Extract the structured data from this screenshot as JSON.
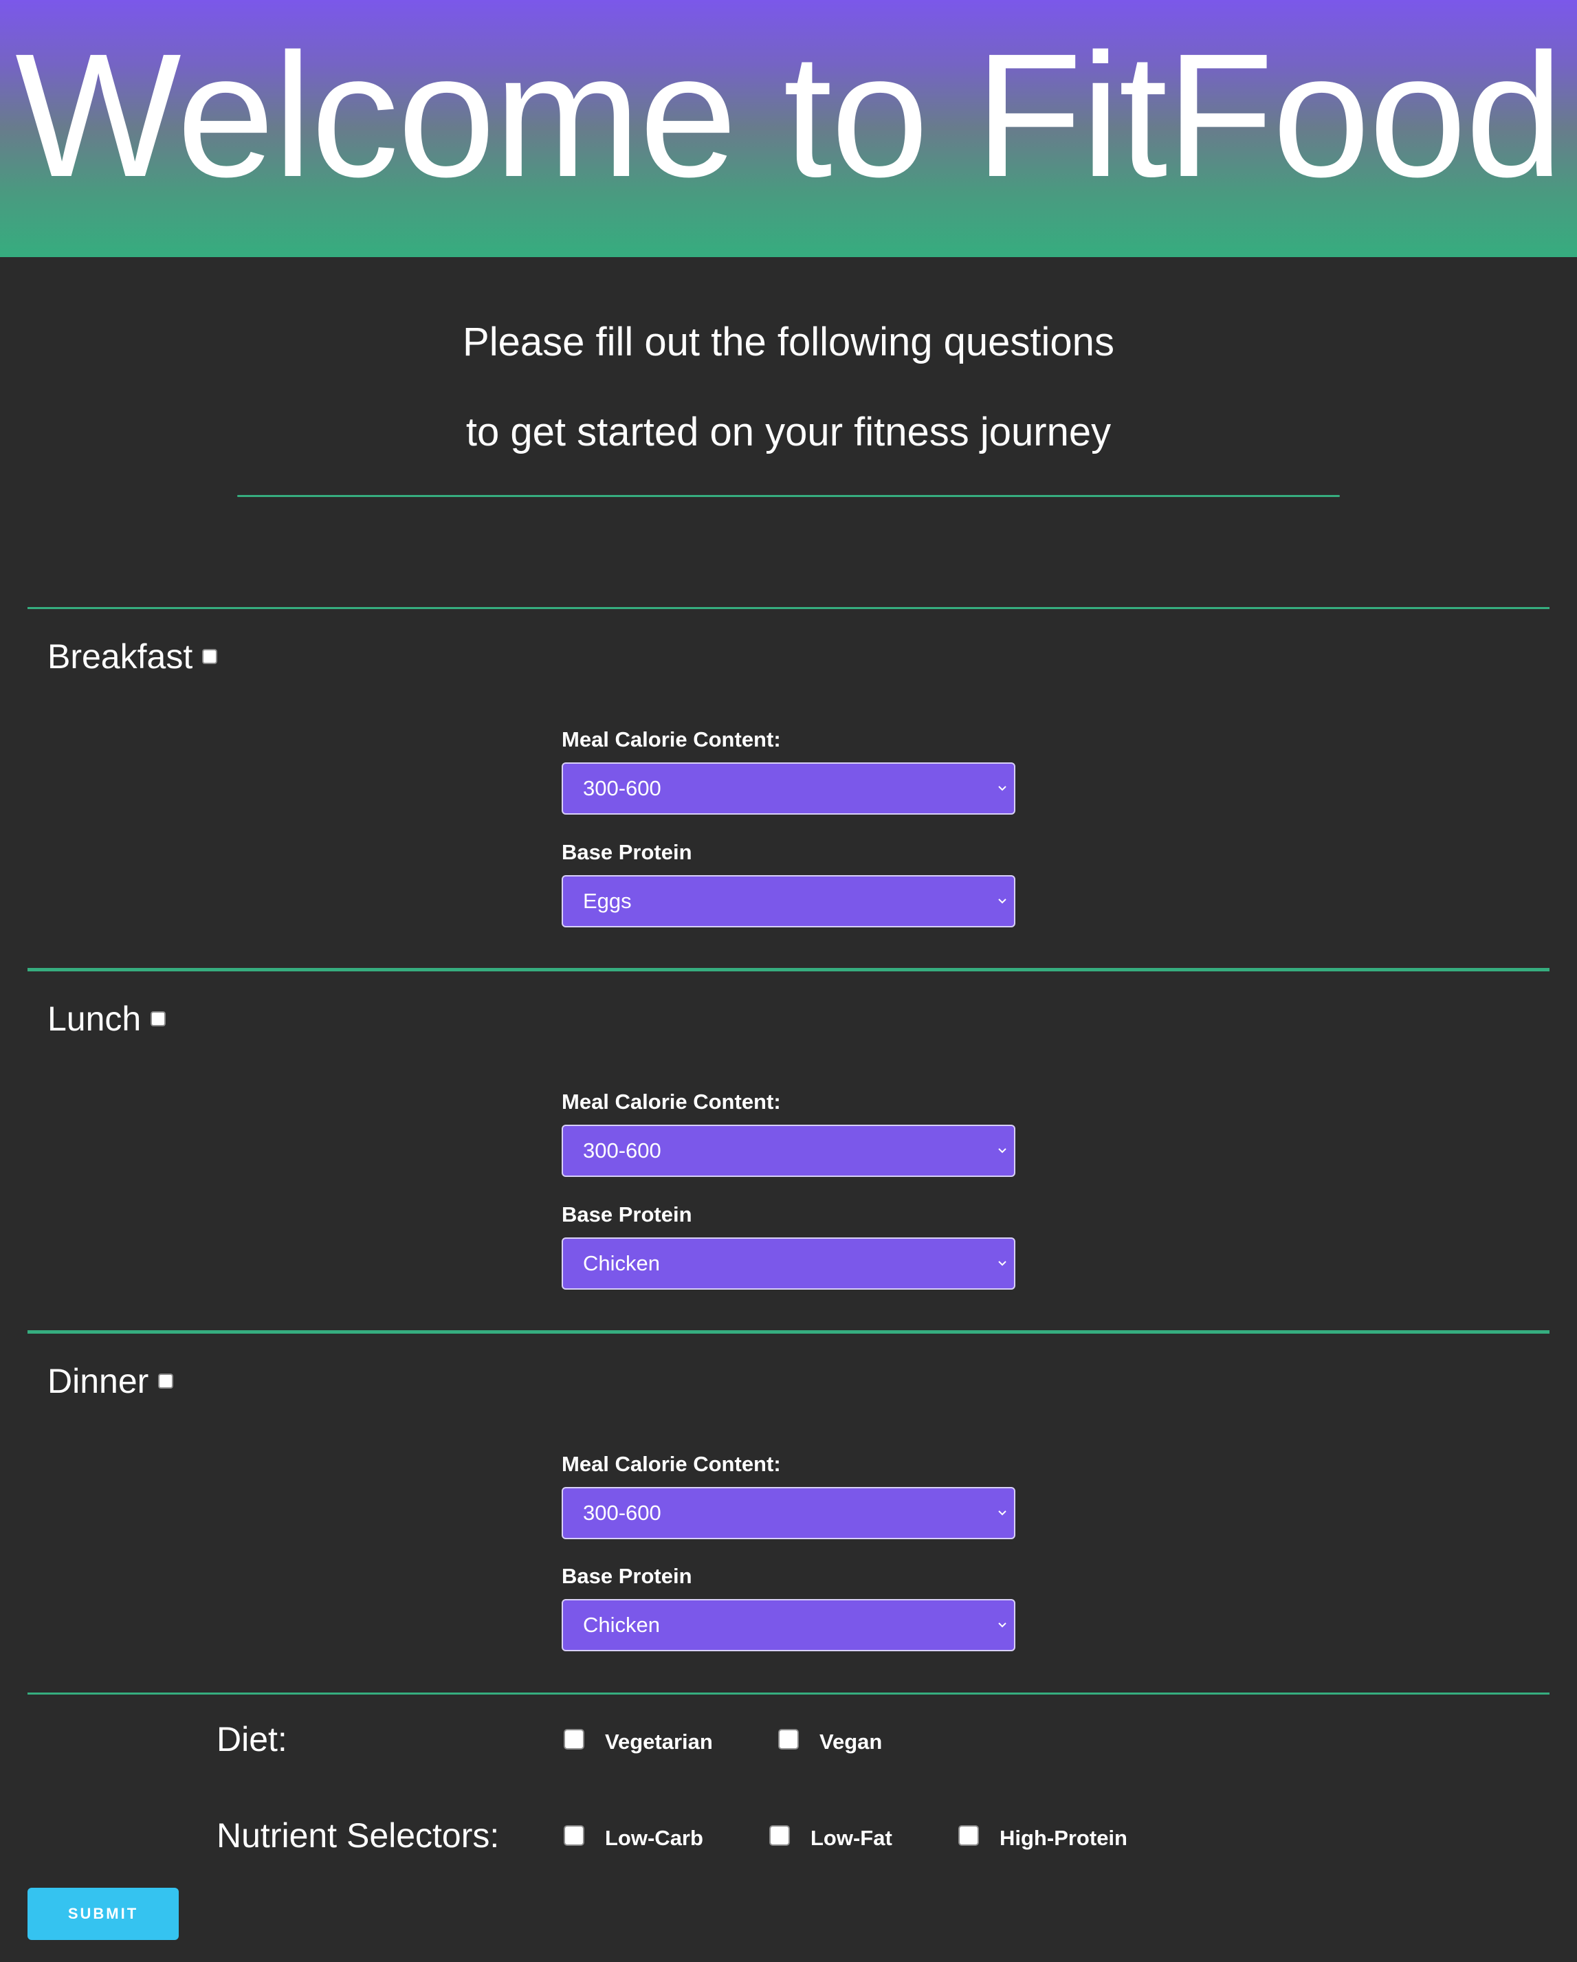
{
  "header": {
    "title": "Welcome to FitFood"
  },
  "intro": {
    "line1": "Please fill out the following questions",
    "line2": "to get started on your fitness journey"
  },
  "meals": [
    {
      "title": "Breakfast",
      "calorie_label": "Meal Calorie Content:",
      "calorie_value": "300-600",
      "protein_label": "Base Protein",
      "protein_value": "Eggs"
    },
    {
      "title": "Lunch",
      "calorie_label": "Meal Calorie Content:",
      "calorie_value": "300-600",
      "protein_label": "Base Protein",
      "protein_value": "Chicken"
    },
    {
      "title": "Dinner",
      "calorie_label": "Meal Calorie Content:",
      "calorie_value": "300-600",
      "protein_label": "Base Protein",
      "protein_value": "Chicken"
    }
  ],
  "diet": {
    "label": "Diet:",
    "options": [
      "Vegetarian",
      "Vegan"
    ]
  },
  "nutrients": {
    "label": "Nutrient Selectors:",
    "options": [
      "Low-Carb",
      "Low-Fat",
      "High-Protein"
    ]
  },
  "submit_label": "SUBMIT",
  "colors": {
    "background": "#2b2b2b",
    "accent_purple": "#7b58ea",
    "accent_green": "#36ad7f",
    "submit_blue": "#35c3f0"
  }
}
